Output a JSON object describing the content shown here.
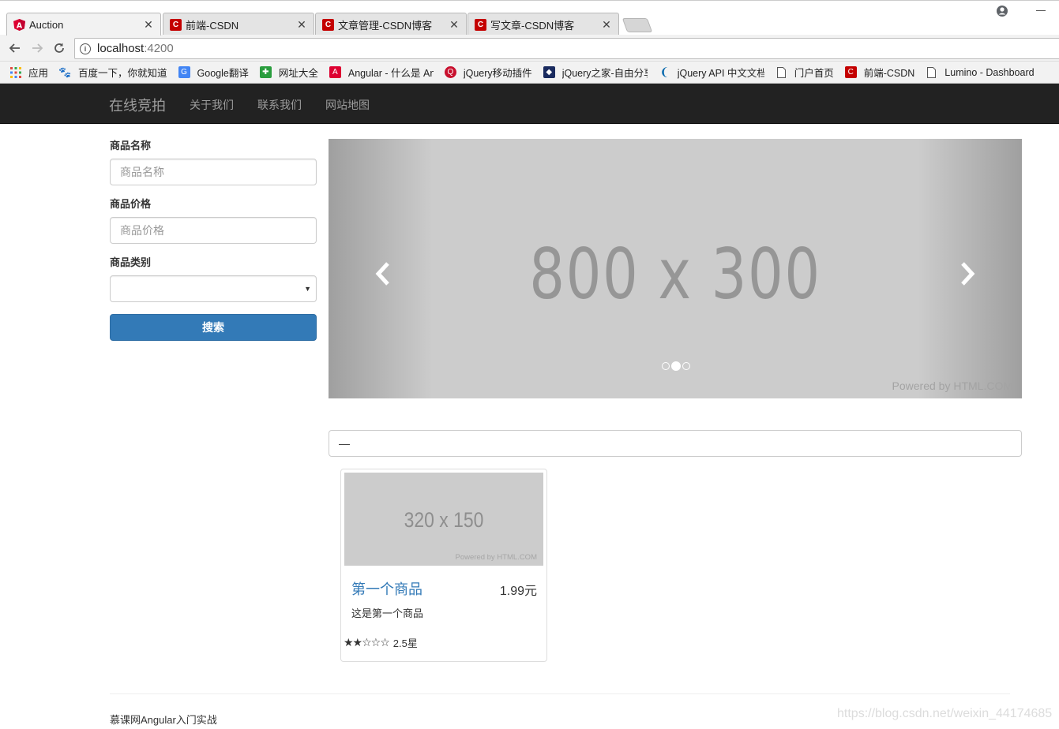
{
  "browser": {
    "tabs": [
      {
        "title": "Auction",
        "icon": "angular-icon",
        "active": true
      },
      {
        "title": "前端-CSDN",
        "icon": "csdn-icon",
        "active": false
      },
      {
        "title": "文章管理-CSDN博客",
        "icon": "csdn-icon",
        "active": false
      },
      {
        "title": "写文章-CSDN博客",
        "icon": "csdn-icon",
        "active": false
      }
    ],
    "address": {
      "host": "localhost",
      "port": ":4200"
    },
    "bookmarks": [
      {
        "label": "应用",
        "icon": "apps-grid-icon",
        "color": "#e04a3f"
      },
      {
        "label": "百度一下，你就知道",
        "icon": "baidu-paw-icon",
        "color": "#2932e1"
      },
      {
        "label": "Google翻译",
        "icon": "google-translate-icon",
        "color": "#4285f4"
      },
      {
        "label": "网址大全",
        "icon": "hao123-icon",
        "color": "#2a9d3e"
      },
      {
        "label": "Angular - 什么是 Ang",
        "icon": "angular-icon",
        "color": "#dd0031"
      },
      {
        "label": "jQuery移动插件",
        "icon": "jquery-plugin-icon",
        "color": "#c8102e"
      },
      {
        "label": "jQuery之家-自由分享",
        "icon": "jquery-home-icon",
        "color": "#1a2b5f"
      },
      {
        "label": "jQuery API 中文文档",
        "icon": "jquery-api-icon",
        "color": "#0769ad"
      },
      {
        "label": "门户首页",
        "icon": "page-icon",
        "color": "#666666"
      },
      {
        "label": "前端-CSDN",
        "icon": "csdn-icon",
        "color": "#c40000"
      },
      {
        "label": "Lumino - Dashboard",
        "icon": "page-icon",
        "color": "#666666"
      }
    ]
  },
  "navbar": {
    "brand": "在线竞拍",
    "links": [
      "关于我们",
      "联系我们",
      "网站地图"
    ]
  },
  "search_form": {
    "name_label": "商品名称",
    "name_placeholder": "商品名称",
    "price_label": "商品价格",
    "price_placeholder": "商品价格",
    "category_label": "商品类别",
    "category_value": "",
    "submit_label": "搜索"
  },
  "carousel": {
    "image_label": "800 x 300",
    "powered": "Powered by HTML.COM",
    "slide_count": 3,
    "active_index": 1
  },
  "filter_bar": {
    "text": "—"
  },
  "products": [
    {
      "image_label": "320 x 150",
      "powered": "Powered by HTML.COM",
      "name": "第一个商品",
      "price": "1.99元",
      "description": "这是第一个商品",
      "stars": "★★☆☆☆",
      "rating_text": "2.5星"
    }
  ],
  "footer": {
    "text": "慕课网Angular入门实战"
  },
  "watermark": "https://blog.csdn.net/weixin_44174685",
  "colors": {
    "navbar": "#222222",
    "primary": "#337ab7",
    "placeholder_bg": "#cccccc"
  }
}
